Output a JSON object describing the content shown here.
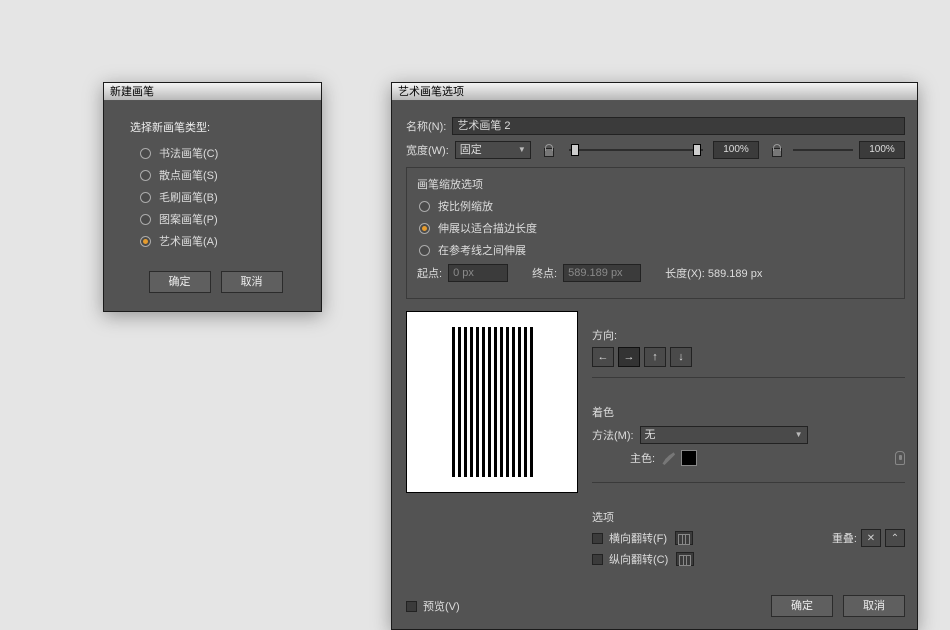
{
  "dlg_new": {
    "title": "新建画笔",
    "prompt": "选择新画笔类型:",
    "options": [
      {
        "label": "书法画笔(C)",
        "selected": false
      },
      {
        "label": "散点画笔(S)",
        "selected": false
      },
      {
        "label": "毛刷画笔(B)",
        "selected": false
      },
      {
        "label": "图案画笔(P)",
        "selected": false
      },
      {
        "label": "艺术画笔(A)",
        "selected": true
      }
    ],
    "ok": "确定",
    "cancel": "取消"
  },
  "dlg_opt": {
    "title": "艺术画笔选项",
    "name_label": "名称(N):",
    "name_value": "艺术画笔 2",
    "width_label": "宽度(W):",
    "width_mode": "固定",
    "width_pct_left": "100%",
    "width_pct_right": "100%",
    "scale_group": "画笔缩放选项",
    "scale_options": [
      {
        "label": "按比例缩放",
        "selected": false
      },
      {
        "label": "伸展以适合描边长度",
        "selected": true
      },
      {
        "label": "在参考线之间伸展",
        "selected": false
      }
    ],
    "start_label": "起点:",
    "start_value": "0 px",
    "end_label": "终点:",
    "end_value": "589.189 px",
    "length_label": "长度(X): 589.189 px",
    "direction_label": "方向:",
    "colorize_label": "着色",
    "method_label": "方法(M):",
    "method_value": "无",
    "keycolor_label": "主色:",
    "options_label": "选项",
    "flip_h": "横向翻转(F)",
    "flip_v": "纵向翻转(C)",
    "overlap_label": "重叠:",
    "preview_label": "预览(V)",
    "ok": "确定",
    "cancel": "取消"
  }
}
